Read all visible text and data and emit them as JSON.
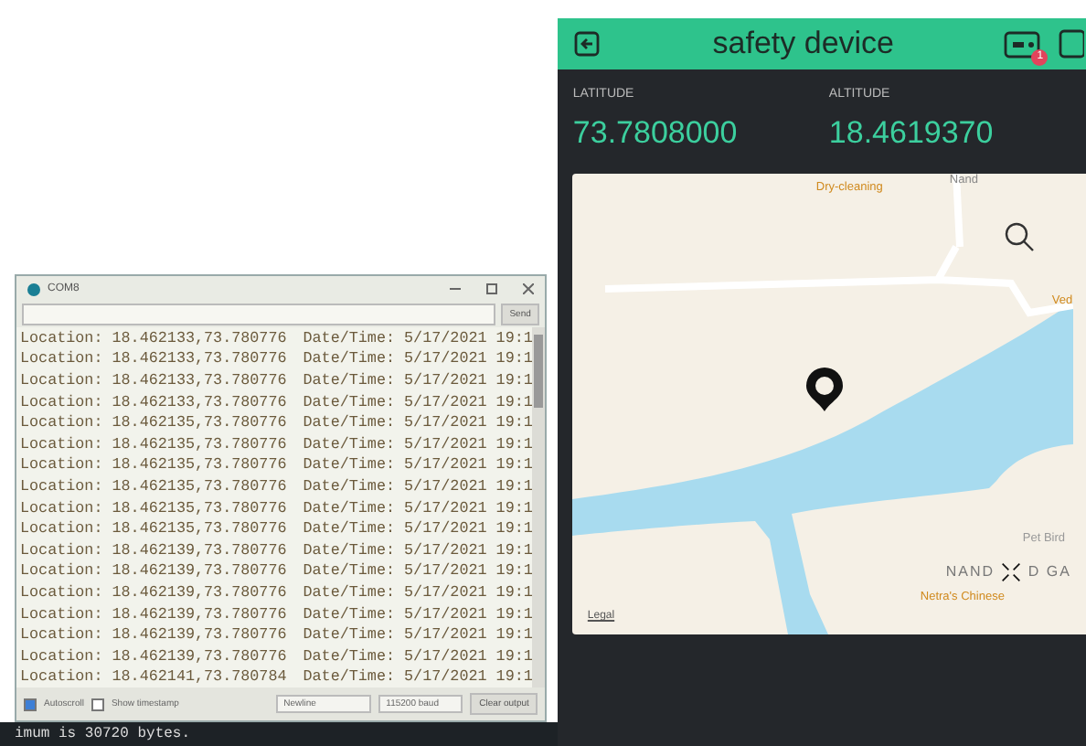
{
  "serial_monitor": {
    "title": "COM8",
    "send_button": "Send",
    "lines": [
      {
        "location": "Location: 18.462133,73.780776",
        "datetime": "Date/Time: 5/17/2021 19:1"
      },
      {
        "location": "Location: 18.462133,73.780776",
        "datetime": "Date/Time: 5/17/2021 19:1"
      },
      {
        "location": "Location: 18.462133,73.780776",
        "datetime": "Date/Time: 5/17/2021 19:1"
      },
      {
        "location": "Location: 18.462133,73.780776",
        "datetime": "Date/Time: 5/17/2021 19:1"
      },
      {
        "location": "Location: 18.462135,73.780776",
        "datetime": "Date/Time: 5/17/2021 19:1"
      },
      {
        "location": "Location: 18.462135,73.780776",
        "datetime": "Date/Time: 5/17/2021 19:1"
      },
      {
        "location": "Location: 18.462135,73.780776",
        "datetime": "Date/Time: 5/17/2021 19:1"
      },
      {
        "location": "Location: 18.462135,73.780776",
        "datetime": "Date/Time: 5/17/2021 19:1"
      },
      {
        "location": "Location: 18.462135,73.780776",
        "datetime": "Date/Time: 5/17/2021 19:1"
      },
      {
        "location": "Location: 18.462135,73.780776",
        "datetime": "Date/Time: 5/17/2021 19:1"
      },
      {
        "location": "Location: 18.462139,73.780776",
        "datetime": "Date/Time: 5/17/2021 19:1"
      },
      {
        "location": "Location: 18.462139,73.780776",
        "datetime": "Date/Time: 5/17/2021 19:1"
      },
      {
        "location": "Location: 18.462139,73.780776",
        "datetime": "Date/Time: 5/17/2021 19:1"
      },
      {
        "location": "Location: 18.462139,73.780776",
        "datetime": "Date/Time: 5/17/2021 19:1"
      },
      {
        "location": "Location: 18.462139,73.780776",
        "datetime": "Date/Time: 5/17/2021 19:1"
      },
      {
        "location": "Location: 18.462139,73.780776",
        "datetime": "Date/Time: 5/17/2021 19:1"
      },
      {
        "location": "Location: 18.462141,73.780784",
        "datetime": "Date/Time: 5/17/2021 19:1"
      }
    ],
    "autoscroll": {
      "label": "Autoscroll",
      "checked": true
    },
    "show_timestamp": {
      "label": "Show timestamp",
      "checked": false
    },
    "line_ending": "Newline",
    "baud": "115200 baud",
    "clear_button": "Clear output",
    "console": "imum is 30720 bytes."
  },
  "app": {
    "title": "safety device",
    "badge": "1",
    "fields": [
      {
        "label": "LATITUDE",
        "value": "73.7808000"
      },
      {
        "label": "ALTITUDE",
        "value": "18.4619370"
      }
    ],
    "map": {
      "labels": [
        {
          "kind": "poi",
          "text": "Dry-cleaning"
        },
        {
          "kind": "road",
          "text": "Nand"
        },
        {
          "kind": "poi",
          "text": "Ved"
        },
        {
          "kind": "place",
          "text": "Pet Bird"
        },
        {
          "kind": "area",
          "text": "NAND"
        },
        {
          "kind": "area",
          "text": "D GA"
        },
        {
          "kind": "poi",
          "text": "Netra's Chinese"
        }
      ],
      "legal": "Legal"
    }
  }
}
